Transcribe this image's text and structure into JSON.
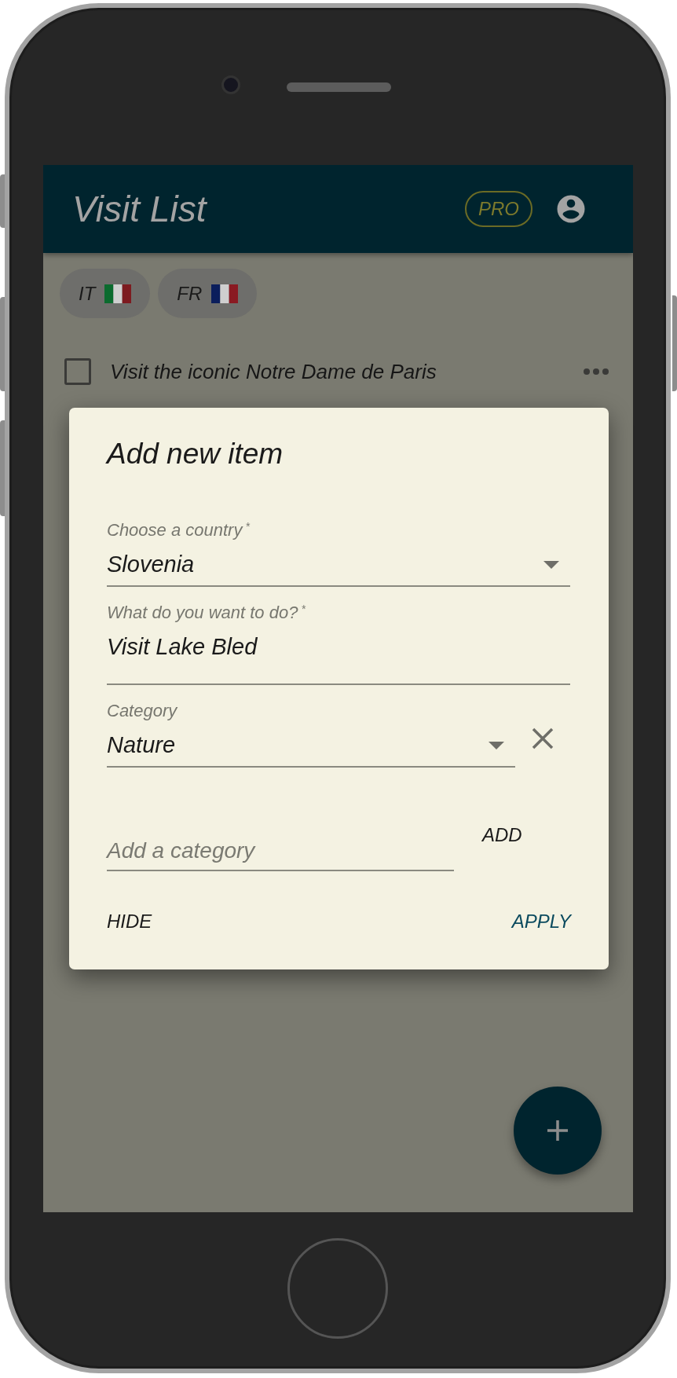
{
  "app_bar": {
    "title": "Visit List",
    "badge": "PRO"
  },
  "filters": [
    {
      "label": "IT"
    },
    {
      "label": "FR"
    }
  ],
  "items": [
    {
      "text": "Visit the iconic Notre Dame de Paris",
      "checked": false
    }
  ],
  "dialog": {
    "title": "Add new item",
    "fields": [
      {
        "kind": "select",
        "label": "Choose a country",
        "required_mark": "*",
        "value": "Slovenia"
      },
      {
        "kind": "text",
        "label": "What do you want to do?",
        "required_mark": "*",
        "value": "Visit Lake Bled"
      },
      {
        "kind": "select",
        "label": "Category",
        "value": "Nature",
        "clearable": true
      }
    ],
    "new_category": {
      "placeholder": "Add a category",
      "button": "ADD"
    },
    "actions": [
      {
        "label": "HIDE",
        "primary": false
      },
      {
        "label": "APPLY",
        "primary": true
      }
    ]
  }
}
